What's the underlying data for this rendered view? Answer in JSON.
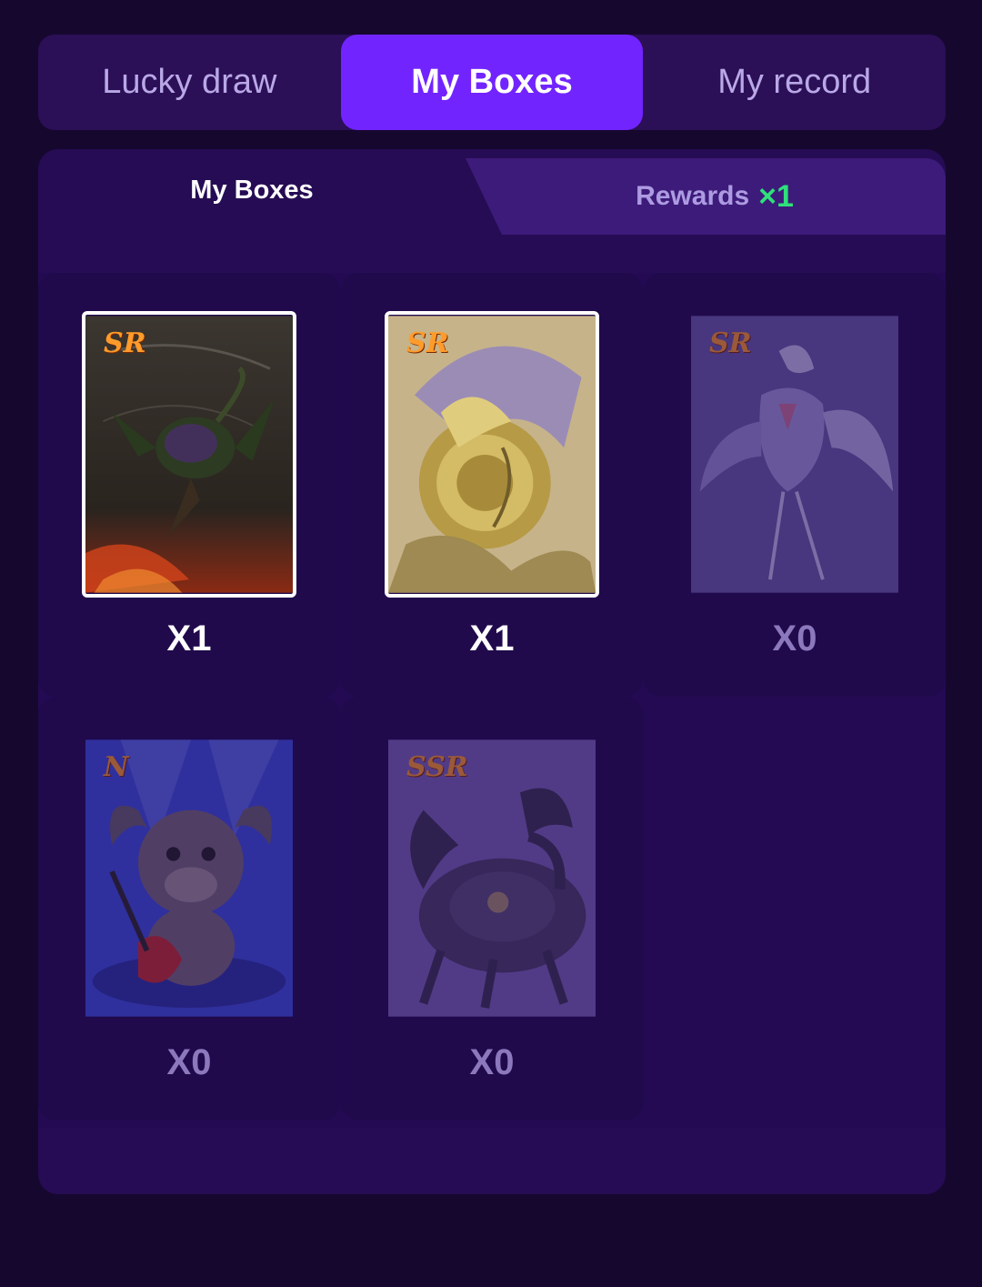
{
  "top_tabs": [
    {
      "label": "Lucky draw",
      "active": false
    },
    {
      "label": "My Boxes",
      "active": true
    },
    {
      "label": "My record",
      "active": false
    }
  ],
  "sub_tabs": {
    "left_label": "My Boxes",
    "right_label": "Rewards",
    "reward_badge": "×1"
  },
  "boxes": [
    {
      "rarity": "SR",
      "count": "X1",
      "owned": true,
      "art": "dark-dragon-icon"
    },
    {
      "rarity": "SR",
      "count": "X1",
      "owned": true,
      "art": "golden-dragon-icon"
    },
    {
      "rarity": "SR",
      "count": "X0",
      "owned": false,
      "art": "phoenix-bird-icon"
    },
    {
      "rarity": "N",
      "count": "X0",
      "owned": false,
      "art": "buffalo-guitarist-icon"
    },
    {
      "rarity": "SSR",
      "count": "X0",
      "owned": false,
      "art": "shadow-beast-icon"
    }
  ],
  "colors": {
    "background": "#16072f",
    "active_tab": "#7224ff",
    "reward_badge": "#2fe07a",
    "rarity_text": "#ff9b2a"
  }
}
